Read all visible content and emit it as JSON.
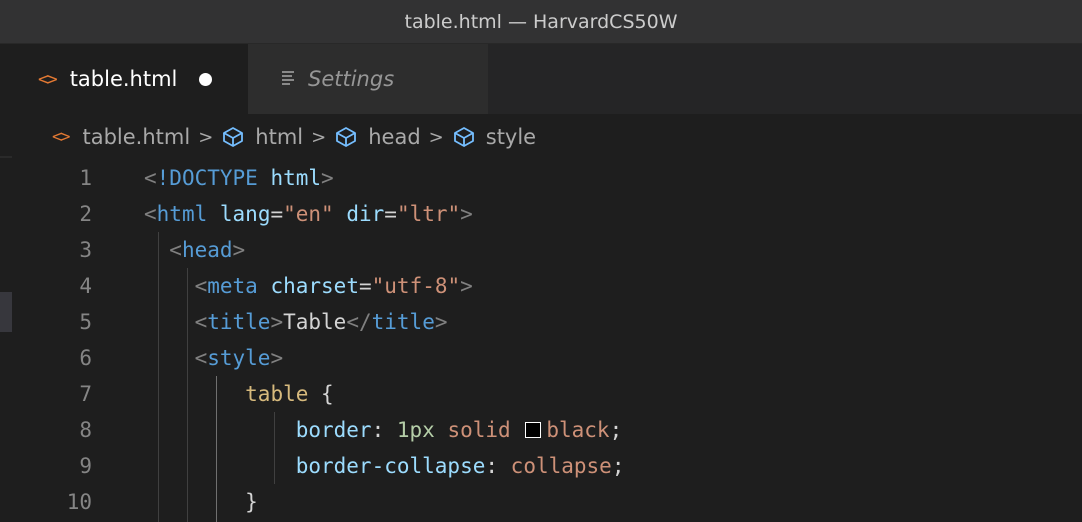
{
  "window": {
    "title": "table.html — HarvardCS50W"
  },
  "tabs": [
    {
      "label": "table.html",
      "icon": "code-brackets-icon",
      "dirty": true,
      "active": true
    },
    {
      "label": "Settings",
      "icon": "menu-lines-icon",
      "active": false
    }
  ],
  "breadcrumb": [
    {
      "label": "table.html",
      "icon": "code-brackets-icon"
    },
    {
      "label": "html",
      "icon": "cube-icon"
    },
    {
      "label": "head",
      "icon": "cube-icon"
    },
    {
      "label": "style",
      "icon": "cube-icon"
    }
  ],
  "editor": {
    "lines": [
      {
        "num": "1",
        "tokens": [
          {
            "t": "<",
            "c": "punct"
          },
          {
            "t": "!DOCTYPE",
            "c": "doctype"
          },
          {
            "t": " ",
            "c": "text"
          },
          {
            "t": "html",
            "c": "attr"
          },
          {
            "t": ">",
            "c": "punct"
          }
        ]
      },
      {
        "num": "2",
        "tokens": [
          {
            "t": "<",
            "c": "punct"
          },
          {
            "t": "html",
            "c": "tag"
          },
          {
            "t": " ",
            "c": "text"
          },
          {
            "t": "lang",
            "c": "attr"
          },
          {
            "t": "=",
            "c": "text"
          },
          {
            "t": "\"en\"",
            "c": "str"
          },
          {
            "t": " ",
            "c": "text"
          },
          {
            "t": "dir",
            "c": "attr"
          },
          {
            "t": "=",
            "c": "text"
          },
          {
            "t": "\"ltr\"",
            "c": "str"
          },
          {
            "t": ">",
            "c": "punct"
          }
        ]
      },
      {
        "num": "3",
        "tokens": [
          {
            "t": "  ",
            "c": "text"
          },
          {
            "t": "<",
            "c": "punct"
          },
          {
            "t": "head",
            "c": "tag"
          },
          {
            "t": ">",
            "c": "punct"
          }
        ]
      },
      {
        "num": "4",
        "tokens": [
          {
            "t": "    ",
            "c": "text"
          },
          {
            "t": "<",
            "c": "punct"
          },
          {
            "t": "meta",
            "c": "tag"
          },
          {
            "t": " ",
            "c": "text"
          },
          {
            "t": "charset",
            "c": "attr"
          },
          {
            "t": "=",
            "c": "text"
          },
          {
            "t": "\"utf-8\"",
            "c": "str"
          },
          {
            "t": ">",
            "c": "punct"
          }
        ]
      },
      {
        "num": "5",
        "tokens": [
          {
            "t": "    ",
            "c": "text"
          },
          {
            "t": "<",
            "c": "punct"
          },
          {
            "t": "title",
            "c": "tag"
          },
          {
            "t": ">",
            "c": "punct"
          },
          {
            "t": "Table",
            "c": "text"
          },
          {
            "t": "</",
            "c": "punct"
          },
          {
            "t": "title",
            "c": "tag"
          },
          {
            "t": ">",
            "c": "punct"
          }
        ]
      },
      {
        "num": "6",
        "tokens": [
          {
            "t": "    ",
            "c": "text"
          },
          {
            "t": "<",
            "c": "punct"
          },
          {
            "t": "style",
            "c": "tag"
          },
          {
            "t": ">",
            "c": "punct"
          }
        ]
      },
      {
        "num": "7",
        "tokens": [
          {
            "t": "        ",
            "c": "text"
          },
          {
            "t": "table",
            "c": "sel"
          },
          {
            "t": " {",
            "c": "text"
          }
        ]
      },
      {
        "num": "8",
        "tokens": [
          {
            "t": "            ",
            "c": "text"
          },
          {
            "t": "border",
            "c": "prop"
          },
          {
            "t": ": ",
            "c": "text"
          },
          {
            "t": "1px",
            "c": "num"
          },
          {
            "t": " ",
            "c": "text"
          },
          {
            "t": "solid",
            "c": "val"
          },
          {
            "t": " ",
            "c": "text"
          },
          {
            "t": "",
            "c": "swatch",
            "color": "#000000"
          },
          {
            "t": "black",
            "c": "val"
          },
          {
            "t": ";",
            "c": "text"
          }
        ]
      },
      {
        "num": "9",
        "tokens": [
          {
            "t": "            ",
            "c": "text"
          },
          {
            "t": "border-collapse",
            "c": "prop"
          },
          {
            "t": ": ",
            "c": "text"
          },
          {
            "t": "collapse",
            "c": "val"
          },
          {
            "t": ";",
            "c": "text"
          }
        ]
      },
      {
        "num": "10",
        "tokens": [
          {
            "t": "        ",
            "c": "text"
          },
          {
            "t": "}",
            "c": "text"
          }
        ]
      }
    ]
  },
  "colors": {
    "titlebar_bg": "#323233",
    "editor_bg": "#1e1e1e",
    "tab_inactive_bg": "#2d2d2d",
    "html_icon": "#e37933",
    "cube_icon": "#75beff"
  }
}
